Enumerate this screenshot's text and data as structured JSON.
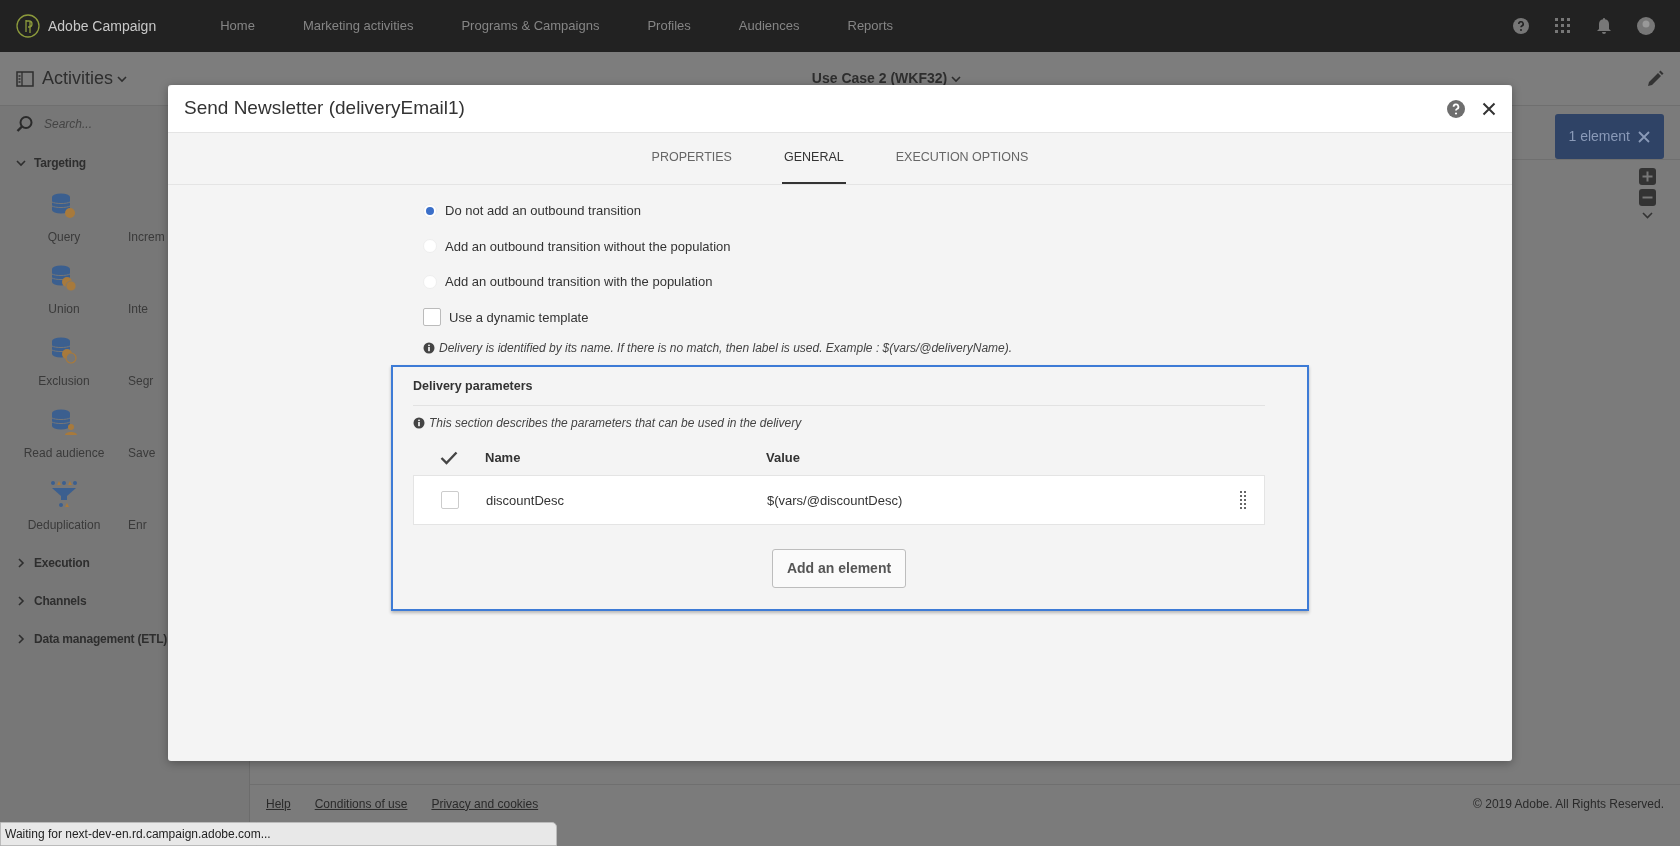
{
  "app": {
    "name": "Adobe Campaign"
  },
  "nav": [
    {
      "label": "Home"
    },
    {
      "label": "Marketing activities"
    },
    {
      "label": "Programs & Campaigns"
    },
    {
      "label": "Profiles"
    },
    {
      "label": "Audiences"
    },
    {
      "label": "Reports"
    }
  ],
  "header": {
    "panel_title": "Activities",
    "workflow_title": "Use Case 2 (WKF32)",
    "selection_badge": "1 element"
  },
  "sidebar": {
    "search_placeholder": "Search...",
    "sections": [
      {
        "label": "Targeting",
        "expanded": true,
        "activities": [
          {
            "label": "Query",
            "kind": "query"
          },
          {
            "label": "Increm",
            "kind": "hidden"
          },
          {
            "label": "Union",
            "kind": "union"
          },
          {
            "label": "Inte",
            "kind": "hidden"
          },
          {
            "label": "Exclusion",
            "kind": "exclusion"
          },
          {
            "label": "Segr",
            "kind": "hidden"
          },
          {
            "label": "Read audience",
            "kind": "audience"
          },
          {
            "label": "Save",
            "kind": "hidden"
          },
          {
            "label": "Deduplication",
            "kind": "dedup"
          },
          {
            "label": "Enr",
            "kind": "hidden"
          }
        ]
      },
      {
        "label": "Execution",
        "expanded": false
      },
      {
        "label": "Channels",
        "expanded": false
      },
      {
        "label": "Data management (ETL)",
        "expanded": false
      }
    ]
  },
  "footer": {
    "links": [
      "Help",
      "Conditions of use",
      "Privacy and cookies"
    ],
    "copyright": "© 2019 Adobe. All Rights Reserved."
  },
  "status_bar": "Waiting for next-dev-en.rd.campaign.adobe.com...",
  "modal": {
    "title": "Send Newsletter (deliveryEmail1)",
    "tabs": [
      {
        "label": "PROPERTIES",
        "selected": false
      },
      {
        "label": "GENERAL",
        "selected": true
      },
      {
        "label": "EXECUTION OPTIONS",
        "selected": false
      }
    ],
    "transitions": [
      {
        "label": "Do not add an outbound transition",
        "selected": true
      },
      {
        "label": "Add an outbound transition without the population",
        "selected": false
      },
      {
        "label": "Add an outbound transition with the population",
        "selected": false
      }
    ],
    "dynamic_template": {
      "label": "Use a dynamic template",
      "checked": false
    },
    "info": "Delivery is identified by its name. If there is no match, then label is used. Example : $(vars/@deliveryName).",
    "parameters": {
      "title": "Delivery parameters",
      "note": "This section describes the parameters that can be used in the delivery",
      "columns": [
        "Name",
        "Value"
      ],
      "rows": [
        {
          "name": "discountDesc",
          "value": "$(vars/@discountDesc)",
          "checked": false
        }
      ],
      "add_button": "Add an element"
    }
  }
}
